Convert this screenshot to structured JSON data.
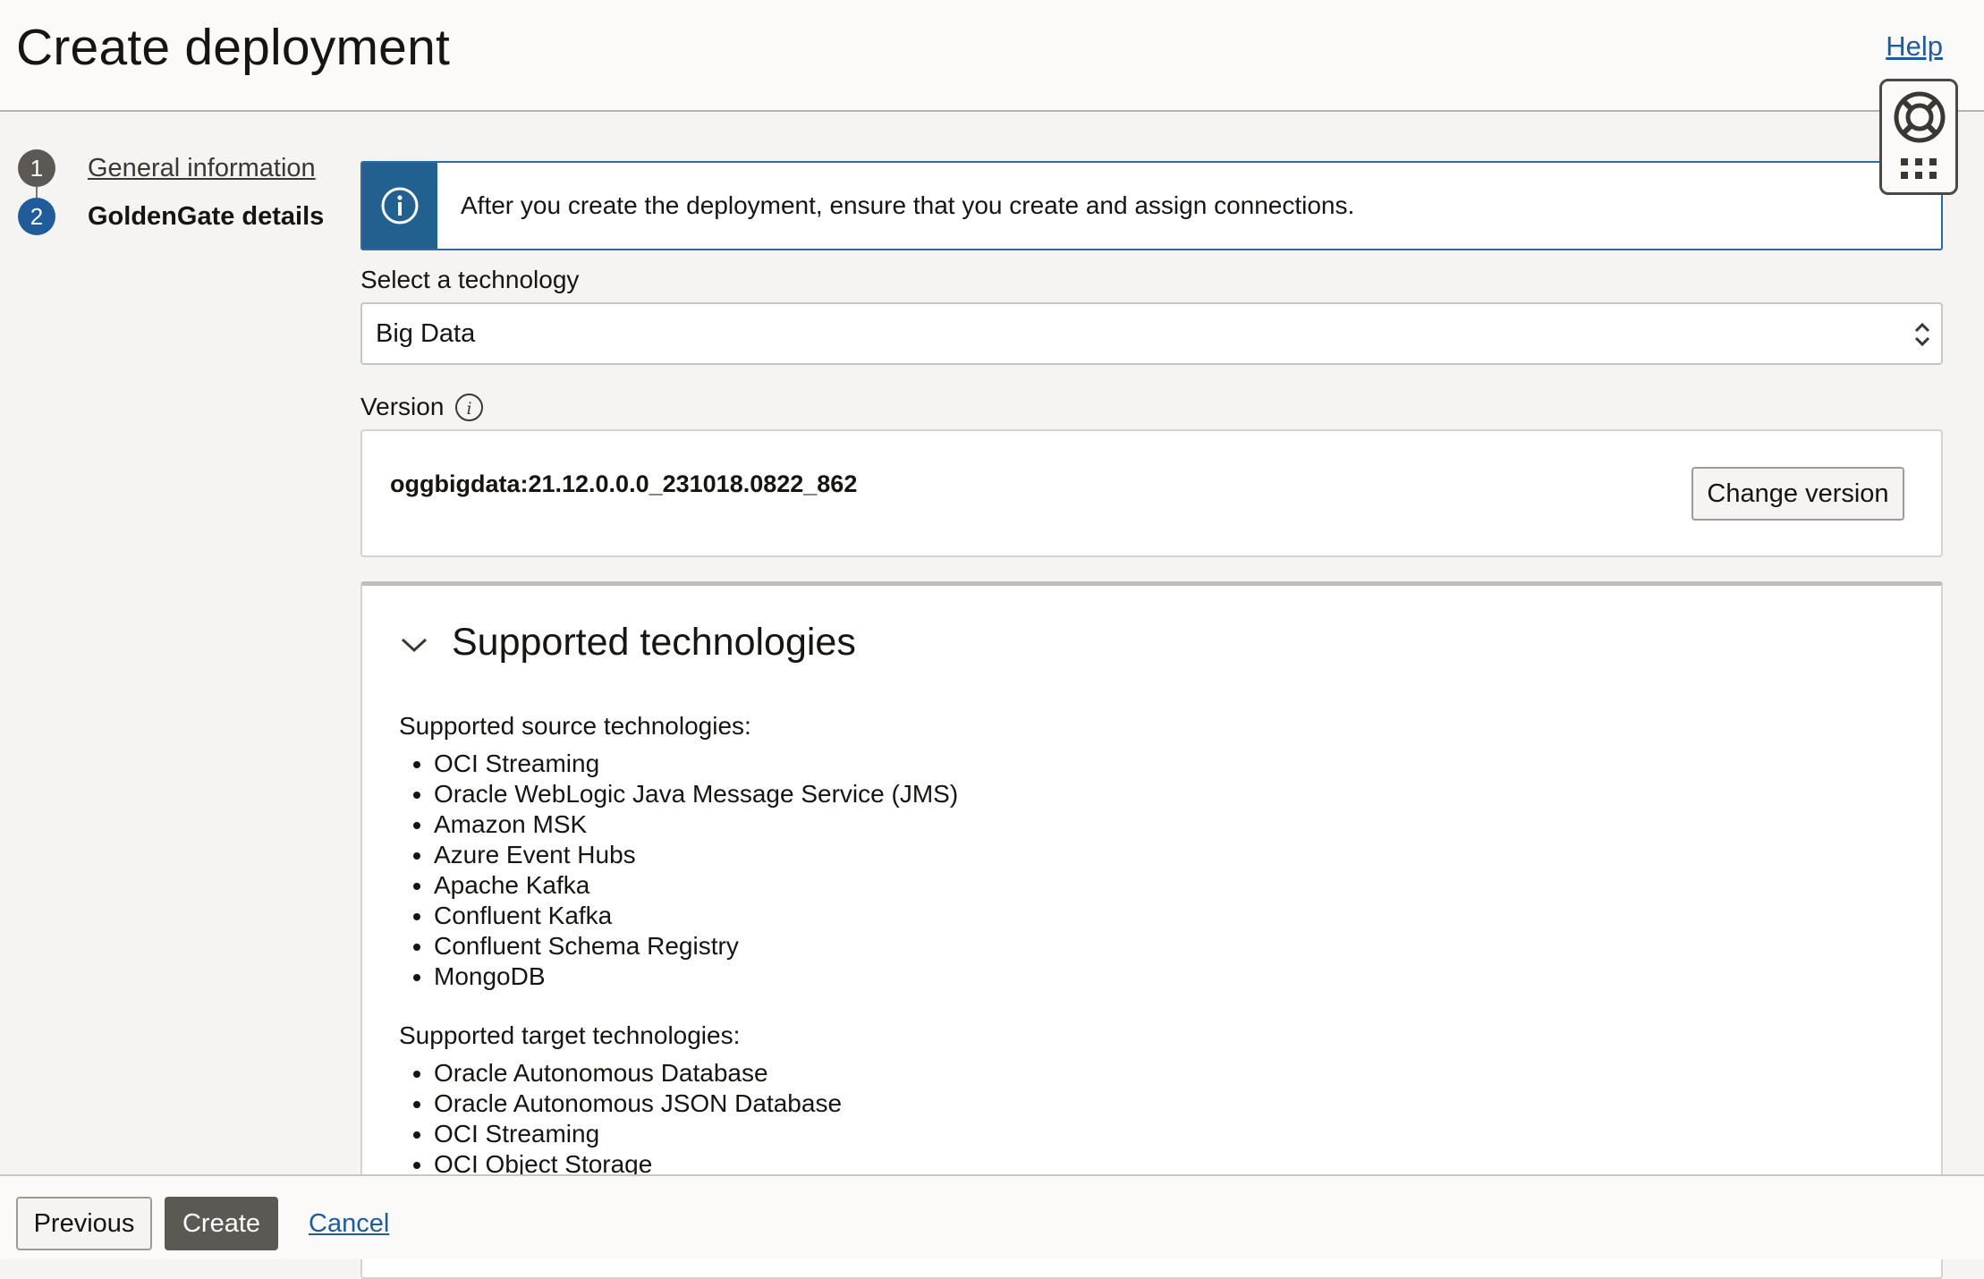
{
  "header": {
    "title": "Create deployment",
    "help_label": "Help"
  },
  "steps": [
    {
      "number": "1",
      "label": "General information",
      "state": "completed"
    },
    {
      "number": "2",
      "label": "GoldenGate details",
      "state": "current"
    }
  ],
  "info_banner": {
    "message": "After you create the deployment, ensure that you create and assign connections."
  },
  "technology": {
    "label": "Select a technology",
    "value": "Big Data"
  },
  "version": {
    "label": "Version",
    "value": "oggbigdata:21.12.0.0.0_231018.0822_862",
    "change_label": "Change version"
  },
  "supported": {
    "title": "Supported technologies",
    "source_label": "Supported source technologies:",
    "source_items": [
      "OCI Streaming",
      "Oracle WebLogic Java Message Service (JMS)",
      "Amazon MSK",
      "Azure Event Hubs",
      "Apache Kafka",
      "Confluent Kafka",
      "Confluent Schema Registry",
      "MongoDB"
    ],
    "target_label": "Supported target technologies:",
    "target_items": [
      "Oracle Autonomous Database",
      "Oracle Autonomous JSON Database",
      "OCI Streaming",
      "OCI Object Storage"
    ]
  },
  "footer": {
    "previous_label": "Previous",
    "create_label": "Create",
    "cancel_label": "Cancel"
  },
  "colors": {
    "accent": "#1f5c99",
    "primary_button": "#5c5954",
    "banner_icon_bg": "#22618f"
  },
  "icons": {
    "help_widget": "lifebuoy-icon",
    "apps": "grid-dots-icon",
    "info": "info-icon",
    "select": "chevron-updown-icon",
    "collapse": "chevron-down-icon"
  }
}
